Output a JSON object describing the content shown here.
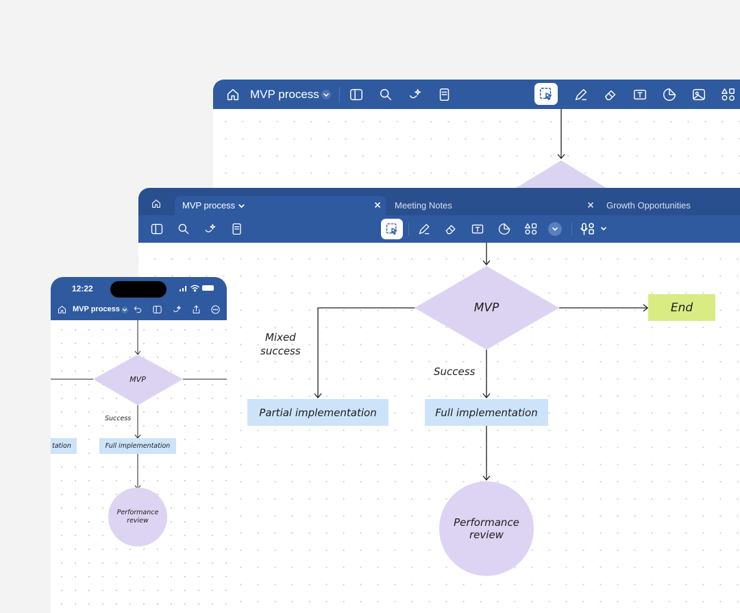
{
  "back_window": {
    "title": "MVP process"
  },
  "main_window": {
    "tabs": [
      {
        "label": "MVP process",
        "active": true
      },
      {
        "label": "Meeting Notes",
        "active": false
      },
      {
        "label": "Growth Opportunities",
        "active": false
      }
    ]
  },
  "phone": {
    "time": "12:22",
    "title": "MVP process"
  },
  "diagram": {
    "decision": "MVP",
    "end": "End",
    "mixed_success": "Mixed\nsuccess",
    "success": "Success",
    "partial": "Partial implementation",
    "full": "Full implementation",
    "review": "Performance\nreview",
    "partial_truncated": "tation"
  },
  "colors": {
    "toolbar": "#2f5aa0",
    "tabbar": "#2a4f8e",
    "diamond": "#dcd3f2",
    "box": "#cde3fa",
    "end_box": "#d9ec84",
    "circle": "#ddd3f2"
  }
}
